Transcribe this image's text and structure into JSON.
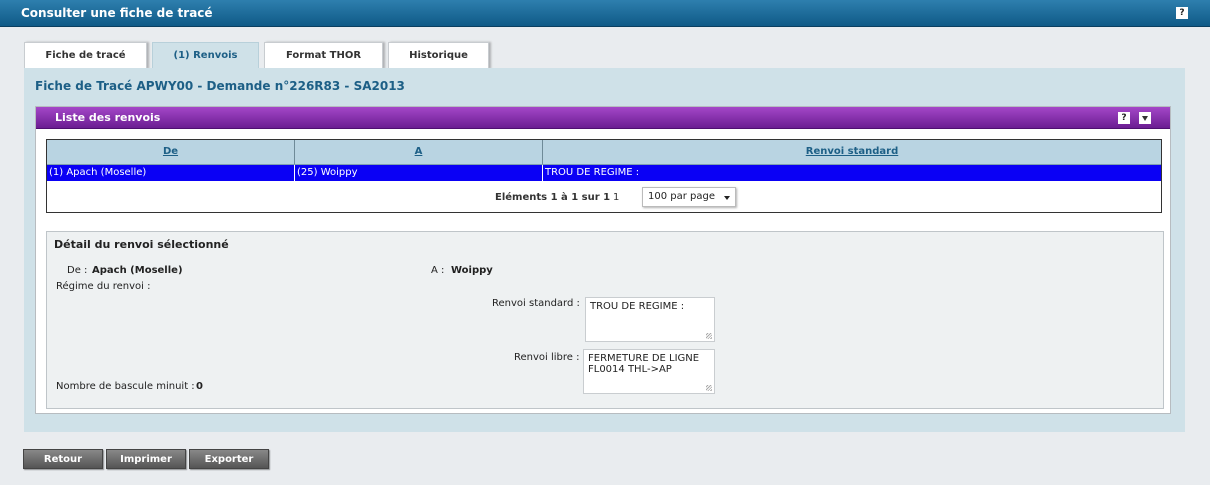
{
  "window": {
    "title": "Consulter une fiche de tracé",
    "help": "?"
  },
  "tabs": [
    {
      "label": "Fiche de tracé"
    },
    {
      "label": "(1) Renvois"
    },
    {
      "label": "Format THOR"
    },
    {
      "label": "Historique"
    }
  ],
  "panel": {
    "title": "Fiche de Tracé APWY00 - Demande n°226R83 - SA2013"
  },
  "section": {
    "title": "Liste des renvois",
    "help": "?"
  },
  "table": {
    "headers": [
      "De",
      "A",
      "Renvoi standard"
    ],
    "rows": [
      [
        "(1) Apach (Moselle)",
        "(25) Woippy",
        "TROU DE REGIME :"
      ]
    ]
  },
  "pager": {
    "count_text": "Eléments 1 à 1 sur 1",
    "page": "1",
    "per_page": "100 par page"
  },
  "detail": {
    "title": "Détail du renvoi sélectionné",
    "de_label": "De :",
    "de_value": "Apach (Moselle)",
    "a_label": "A :",
    "a_value": "Woippy",
    "regime_label": "Régime du renvoi :",
    "renvoi_standard_label": "Renvoi standard :",
    "renvoi_standard_value": "TROU DE REGIME :",
    "renvoi_libre_label": "Renvoi libre :",
    "renvoi_libre_line1": "FERMETURE DE LIGNE",
    "renvoi_libre_line2": "FL0014 THL->AP",
    "bascule_label": "Nombre de bascule minuit :",
    "bascule_value": "0"
  },
  "buttons": {
    "back": "Retour",
    "print": "Imprimer",
    "export": "Exporter"
  },
  "colors": {
    "titlebar": "#0f5a87",
    "section_bar": "#7a2aa3",
    "selected_row": "#0a00f5",
    "panel_bg": "#cfe1e8"
  }
}
